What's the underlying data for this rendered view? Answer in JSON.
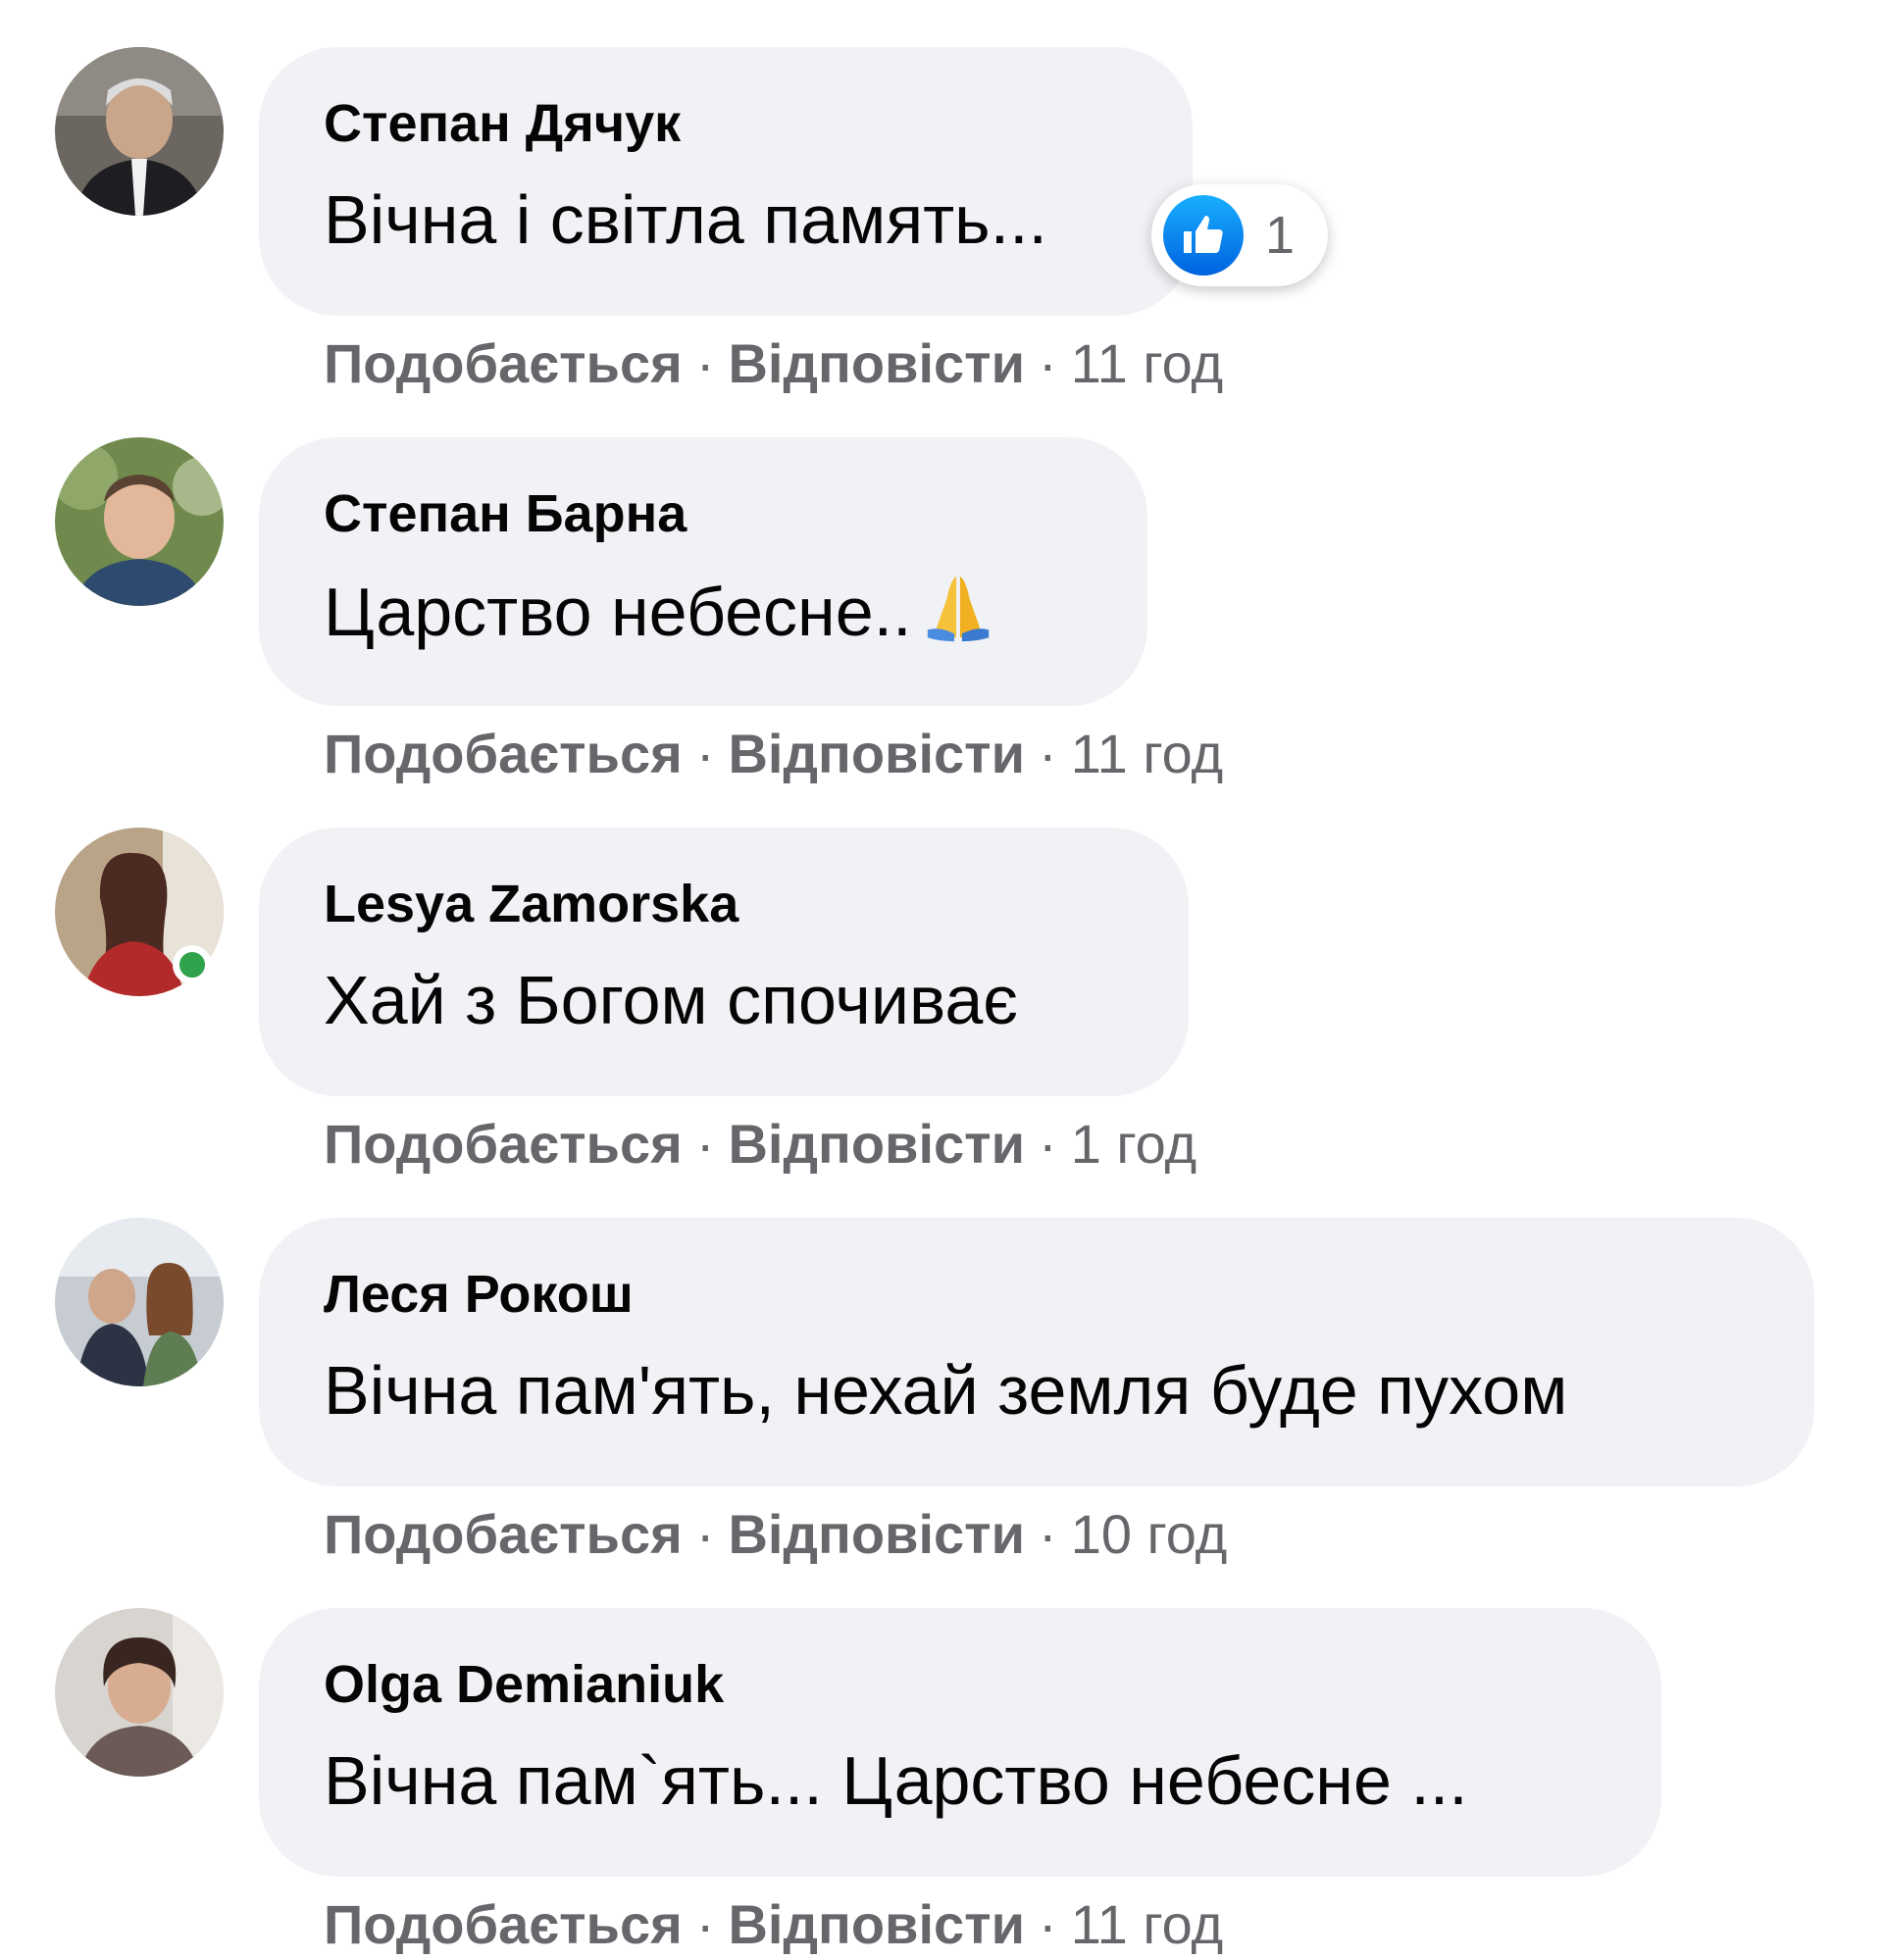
{
  "comments": [
    {
      "author": "Степан Дячук",
      "text": "Вічна і світла память...",
      "reactions": {
        "icon": "like-icon",
        "count": "1"
      },
      "like_label": "Подобається",
      "reply_label": "Відповісти",
      "separator": "·",
      "time": "11 год"
    },
    {
      "author": "Степан Барна",
      "text": "Царство небесне..",
      "emoji": "folded-hands-icon",
      "like_label": "Подобається",
      "reply_label": "Відповісти",
      "separator": "·",
      "time": "11 год"
    },
    {
      "author": "Lesya Zamorska",
      "text": "Хай з Богом спочиває",
      "online": true,
      "like_label": "Подобається",
      "reply_label": "Відповісти",
      "separator": "·",
      "time": "1 год"
    },
    {
      "author": "Леся Рокош",
      "text": "Вічна пам'ять, нехай земля буде пухом",
      "like_label": "Подобається",
      "reply_label": "Відповісти",
      "separator": "·",
      "time": "10 год"
    },
    {
      "author": "Olga Demianiuk",
      "text": "Вічна пам`ять... Царство небесне ...",
      "like_label": "Подобається",
      "reply_label": "Відповісти",
      "separator": "·",
      "time": "11 год"
    }
  ],
  "colors": {
    "bubble": "#f0f2f5",
    "text": "#050505",
    "meta": "#65676b",
    "online": "#31a24c",
    "like_top": "#18afff",
    "like_bottom": "#0062df"
  }
}
